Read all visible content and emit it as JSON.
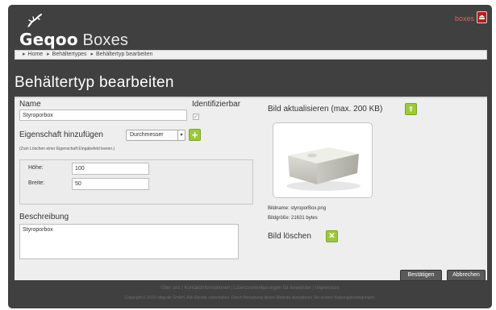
{
  "header": {
    "logo_brand": "Geqoo",
    "logo_suffix": "Boxes",
    "user_label": "boxes",
    "logout_icon_glyph": "⏏"
  },
  "breadcrumb": {
    "items": [
      "Home",
      "Behältertypes",
      "Behältertyp bearbeiten"
    ]
  },
  "page": {
    "title": "Behältertyp bearbeiten"
  },
  "form": {
    "name_label": "Name",
    "name_value": "Styroporbox",
    "identifizierbar_label": "Identifizierbar",
    "identifizierbar_checked": "✓",
    "property_add_label": "Eigenschaft hinzufügen",
    "property_select_value": "Durchmesser",
    "property_hint": "(Zum Löschen einer Eigenschaft Eingabefeld leeren.)",
    "properties": [
      {
        "label": "Höhe:",
        "value": "100"
      },
      {
        "label": "Breite:",
        "value": "50"
      }
    ],
    "description_label": "Beschreibung",
    "description_value": "Styroporbox"
  },
  "image": {
    "update_label": "Bild aktualisieren (max. 200 KB)",
    "filename_line": "Bildname: styroporBox.png",
    "filesize_line": "Bildgröße: 21631 bytes",
    "delete_label": "Bild löschen"
  },
  "actions": {
    "confirm_label": "Bestätigen",
    "cancel_label": "Abbrechen"
  },
  "footer": {
    "links_line": "Über uns | Kontaktinformationen | Lizenzvereinbarungen für Anwender | Impressum",
    "copyright_line": "Copyright © 2010 ubigrate GmbH. Alle Rechte vorbehalten. Durch Benutzung dieser Website akzeptieren Sie unsere Nutzungsbedingungen."
  },
  "colors": {
    "app_bg": "#404040",
    "panel_bg": "#eeeeee",
    "accent_green": "#9cc83a",
    "logout_red": "#b32020"
  }
}
